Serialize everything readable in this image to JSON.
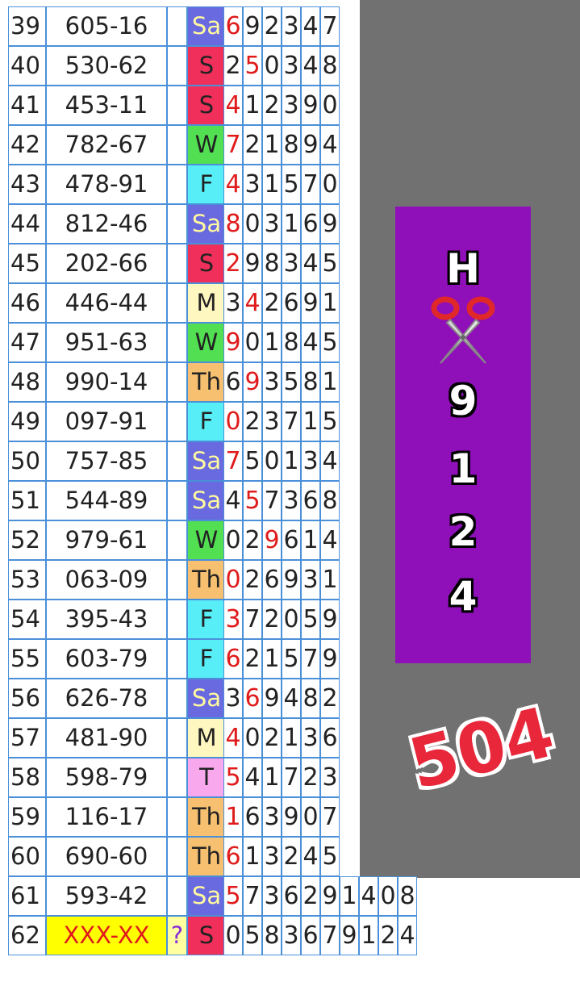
{
  "colors": {
    "Sa": "#6a6ae0",
    "S": "#f0305a",
    "W": "#52e052",
    "F": "#58eef8",
    "M": "#fff7c0",
    "Th": "#f6c070",
    "T": "#f8a8ec",
    "highlight_digit": "#e01b1b",
    "panel_bg": "#8f10b8",
    "sidebar_bg": "#717171",
    "stamp": "#e8283a"
  },
  "rows": [
    {
      "num": "39",
      "code": "605-16",
      "day": "Sa",
      "digits": [
        "6",
        "9",
        "2",
        "3",
        "4",
        "7"
      ],
      "red": [
        0
      ]
    },
    {
      "num": "40",
      "code": "530-62",
      "day": "S",
      "digits": [
        "2",
        "5",
        "0",
        "3",
        "4",
        "8"
      ],
      "red": [
        1
      ]
    },
    {
      "num": "41",
      "code": "453-11",
      "day": "S",
      "digits": [
        "4",
        "1",
        "2",
        "3",
        "9",
        "0"
      ],
      "red": [
        0
      ]
    },
    {
      "num": "42",
      "code": "782-67",
      "day": "W",
      "digits": [
        "7",
        "2",
        "1",
        "8",
        "9",
        "4"
      ],
      "red": [
        0
      ]
    },
    {
      "num": "43",
      "code": "478-91",
      "day": "F",
      "digits": [
        "4",
        "3",
        "1",
        "5",
        "7",
        "0"
      ],
      "red": [
        0
      ]
    },
    {
      "num": "44",
      "code": "812-46",
      "day": "Sa",
      "digits": [
        "8",
        "0",
        "3",
        "1",
        "6",
        "9"
      ],
      "red": [
        0
      ]
    },
    {
      "num": "45",
      "code": "202-66",
      "day": "S",
      "digits": [
        "2",
        "9",
        "8",
        "3",
        "4",
        "5"
      ],
      "red": [
        0
      ]
    },
    {
      "num": "46",
      "code": "446-44",
      "day": "M",
      "digits": [
        "3",
        "4",
        "2",
        "6",
        "9",
        "1"
      ],
      "red": [
        1
      ]
    },
    {
      "num": "47",
      "code": "951-63",
      "day": "W",
      "digits": [
        "9",
        "0",
        "1",
        "8",
        "4",
        "5"
      ],
      "red": [
        0
      ]
    },
    {
      "num": "48",
      "code": "990-14",
      "day": "Th",
      "digits": [
        "6",
        "9",
        "3",
        "5",
        "8",
        "1"
      ],
      "red": [
        1
      ]
    },
    {
      "num": "49",
      "code": "097-91",
      "day": "F",
      "digits": [
        "0",
        "2",
        "3",
        "7",
        "1",
        "5"
      ],
      "red": [
        0
      ]
    },
    {
      "num": "50",
      "code": "757-85",
      "day": "Sa",
      "digits": [
        "7",
        "5",
        "0",
        "1",
        "3",
        "4"
      ],
      "red": [
        0
      ]
    },
    {
      "num": "51",
      "code": "544-89",
      "day": "Sa",
      "digits": [
        "4",
        "5",
        "7",
        "3",
        "6",
        "8"
      ],
      "red": [
        1
      ]
    },
    {
      "num": "52",
      "code": "979-61",
      "day": "W",
      "digits": [
        "0",
        "2",
        "9",
        "6",
        "1",
        "4"
      ],
      "red": [
        2
      ]
    },
    {
      "num": "53",
      "code": "063-09",
      "day": "Th",
      "digits": [
        "0",
        "2",
        "6",
        "9",
        "3",
        "1"
      ],
      "red": [
        0
      ]
    },
    {
      "num": "54",
      "code": "395-43",
      "day": "F",
      "digits": [
        "3",
        "7",
        "2",
        "0",
        "5",
        "9"
      ],
      "red": [
        0
      ]
    },
    {
      "num": "55",
      "code": "603-79",
      "day": "F",
      "digits": [
        "6",
        "2",
        "1",
        "5",
        "7",
        "9"
      ],
      "red": [
        0
      ]
    },
    {
      "num": "56",
      "code": "626-78",
      "day": "Sa",
      "digits": [
        "3",
        "6",
        "9",
        "4",
        "8",
        "2"
      ],
      "red": [
        1
      ]
    },
    {
      "num": "57",
      "code": "481-90",
      "day": "M",
      "digits": [
        "4",
        "0",
        "2",
        "1",
        "3",
        "6"
      ],
      "red": [
        0
      ]
    },
    {
      "num": "58",
      "code": "598-79",
      "day": "T",
      "digits": [
        "5",
        "4",
        "1",
        "7",
        "2",
        "3"
      ],
      "red": [
        0
      ]
    },
    {
      "num": "59",
      "code": "116-17",
      "day": "Th",
      "digits": [
        "1",
        "6",
        "3",
        "9",
        "0",
        "7"
      ],
      "red": [
        0
      ]
    },
    {
      "num": "60",
      "code": "690-60",
      "day": "Th",
      "digits": [
        "6",
        "1",
        "3",
        "2",
        "4",
        "5"
      ],
      "red": [
        0
      ]
    },
    {
      "num": "61",
      "code": "593-42",
      "day": "Sa",
      "digits": [
        "5",
        "7",
        "3",
        "6",
        "2",
        "9",
        "1",
        "4",
        "0",
        "8"
      ],
      "red": [
        0
      ]
    },
    {
      "num": "62",
      "code": "XXX-XX",
      "day": "S",
      "digits": [
        "0",
        "5",
        "8",
        "3",
        "6",
        "7",
        "9",
        "1",
        "2",
        "4"
      ],
      "red": [],
      "question": "?"
    }
  ],
  "panel": {
    "letters": [
      "H",
      "9",
      "1",
      "2",
      "4"
    ],
    "icon": "scissors-icon"
  },
  "stamp_text": "504"
}
